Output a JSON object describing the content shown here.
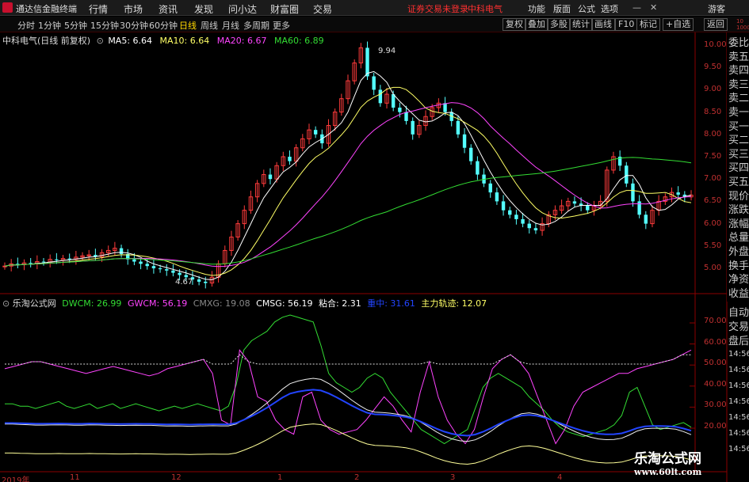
{
  "app": {
    "title": "通达信金融终端",
    "menu": [
      "行情",
      "市场",
      "资讯",
      "发现",
      "问小达",
      "财富圈",
      "交易"
    ],
    "notice": "证券交易未登录",
    "stock_tag": "中科电气",
    "right_menu": [
      "功能",
      "版面",
      "公式",
      "选项"
    ],
    "guest": "游客"
  },
  "toolbar": {
    "periods": [
      "分时",
      "1分钟",
      "5分钟",
      "15分钟",
      "30分钟",
      "60分钟",
      "日线",
      "周线",
      "月线",
      "多周期",
      "更多"
    ],
    "active_period": "日线",
    "buttons": [
      "复权",
      "叠加",
      "多股",
      "统计",
      "画线",
      "F10",
      "标记",
      "+自选",
      "返回"
    ]
  },
  "main_chart": {
    "stock_label": "中科电气(日线 前复权)",
    "ma": [
      {
        "label": "MA5: 6.64",
        "color": "#ffffff"
      },
      {
        "label": "MA10: 6.64",
        "color": "#ffff66"
      },
      {
        "label": "MA20: 6.67",
        "color": "#ff44ff"
      },
      {
        "label": "MA60: 6.89",
        "color": "#33dd33"
      }
    ],
    "high_mark": "9.94",
    "low_mark": "4.67",
    "axis": [
      "10.00",
      "9.50",
      "9.00",
      "8.50",
      "8.00",
      "7.50",
      "7.00",
      "6.50",
      "6.00",
      "5.50",
      "5.00"
    ]
  },
  "indicator": {
    "name": "乐淘公式网",
    "items": [
      {
        "label": "DWCM: 26.99",
        "color": "#33dd33"
      },
      {
        "label": "GWCM: 56.19",
        "color": "#ff44ff"
      },
      {
        "label": "CMXG: 19.08",
        "color": "#888888"
      },
      {
        "label": "CMSG: 56.19",
        "color": "#ffffff"
      },
      {
        "label": "粘合: 2.31",
        "color": "#ffffff"
      },
      {
        "label": "重中: 31.61",
        "color": "#2244ff"
      },
      {
        "label": "主力轨迹: 12.07",
        "color": "#ffff66"
      }
    ],
    "axis": [
      "70.00",
      "60.00",
      "50.00",
      "40.00",
      "30.00",
      "20.00"
    ]
  },
  "sidebar": {
    "top_small": "10\n1000",
    "sell": [
      "委比",
      "卖五",
      "卖四",
      "卖三",
      "卖二",
      "卖一",
      "买一",
      "买二",
      "买三",
      "买四",
      "买五",
      "现价",
      "涨跌",
      "涨幅",
      "总量",
      "外盘",
      "换手",
      "净资",
      "收益"
    ],
    "bottom": [
      "自动",
      "交易",
      "盘后"
    ],
    "times": [
      "14:56",
      "14:56",
      "14:56",
      "14:56",
      "14:56",
      "14:56",
      "14:56"
    ]
  },
  "date_axis": [
    "2019年",
    "11",
    "12",
    "1",
    "2",
    "3",
    "4"
  ],
  "watermark": {
    "title": "乐淘公式网",
    "url": "www.60lt.com"
  },
  "chart_data": {
    "type": "candlestick",
    "price_range": [
      4.5,
      10.1
    ],
    "closes": [
      5.05,
      5.1,
      5.08,
      5.12,
      5.1,
      5.15,
      5.14,
      5.2,
      5.18,
      5.22,
      5.2,
      5.25,
      5.28,
      5.3,
      5.26,
      5.35,
      5.4,
      5.45,
      5.32,
      5.2,
      5.15,
      5.1,
      5.05,
      5.0,
      4.98,
      4.95,
      4.9,
      4.85,
      4.8,
      4.75,
      4.7,
      4.67,
      4.8,
      5.1,
      5.4,
      5.7,
      6.0,
      6.3,
      6.6,
      6.9,
      7.1,
      7.0,
      7.3,
      7.5,
      7.4,
      7.7,
      7.9,
      8.1,
      8.0,
      7.8,
      8.2,
      8.5,
      8.8,
      9.2,
      9.6,
      9.94,
      9.3,
      9.0,
      8.7,
      8.9,
      8.6,
      8.5,
      8.3,
      8.0,
      8.2,
      8.4,
      8.6,
      8.7,
      8.5,
      8.3,
      8.0,
      7.7,
      7.4,
      7.1,
      6.9,
      6.7,
      6.5,
      6.3,
      6.2,
      6.1,
      6.0,
      5.9,
      5.85,
      6.0,
      6.2,
      6.3,
      6.4,
      6.5,
      6.45,
      6.4,
      6.3,
      6.4,
      6.5,
      7.2,
      7.5,
      7.3,
      6.9,
      6.5,
      6.2,
      6.0,
      6.3,
      6.5,
      6.6,
      6.7,
      6.65,
      6.6,
      6.64
    ],
    "indicator_range": [
      10,
      76
    ],
    "DWCM": [
      37,
      37,
      36,
      36,
      35,
      36,
      37,
      38,
      36,
      35,
      36,
      37,
      35,
      36,
      37,
      35,
      36,
      37,
      36,
      35,
      34,
      35,
      36,
      35,
      36,
      37,
      36,
      35,
      34,
      36,
      45,
      60,
      64,
      66,
      68,
      72,
      74,
      75,
      74,
      73,
      72,
      62,
      50,
      46,
      44,
      42,
      44,
      48,
      50,
      48,
      42,
      38,
      34,
      30,
      26,
      24,
      22,
      20,
      22,
      24,
      26,
      35,
      44,
      48,
      50,
      48,
      46,
      44,
      40,
      37,
      34,
      30,
      27,
      25,
      24,
      23,
      24,
      25,
      26,
      28,
      32,
      42,
      44,
      36,
      28,
      26,
      27,
      28,
      29,
      27
    ],
    "GWCM": [
      52,
      53,
      54,
      55,
      55,
      54,
      53,
      52,
      51,
      50,
      51,
      52,
      53,
      52,
      51,
      50,
      49,
      50,
      52,
      53,
      54,
      55,
      56,
      50,
      30,
      28,
      60,
      55,
      40,
      38,
      30,
      26,
      24,
      40,
      42,
      30,
      26,
      24,
      25,
      26,
      30,
      35,
      40,
      36,
      30,
      25,
      42,
      55,
      40,
      30,
      24,
      20,
      26,
      40,
      52,
      56,
      58,
      55,
      50,
      40,
      30,
      20,
      26,
      36,
      42,
      44,
      46,
      48,
      50,
      50,
      52,
      53,
      54,
      55,
      56,
      58,
      60
    ]
  }
}
